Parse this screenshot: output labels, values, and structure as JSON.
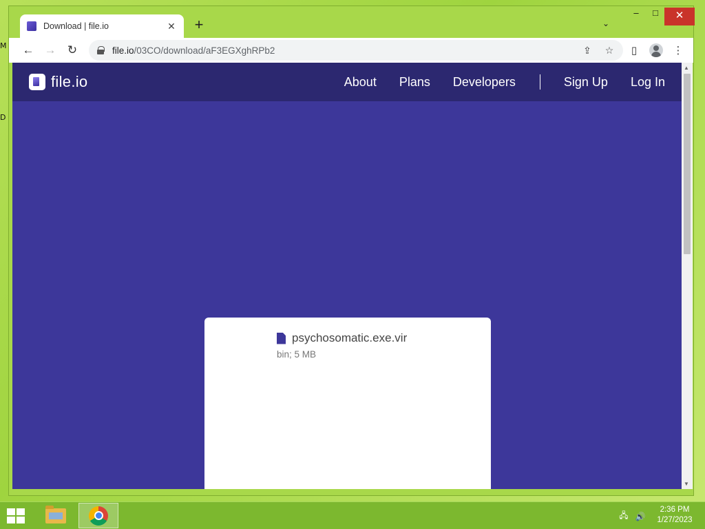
{
  "desktop": {
    "edge_labels": [
      "M",
      "D"
    ]
  },
  "browser": {
    "tab": {
      "title": "Download | file.io",
      "close": "✕"
    },
    "new_tab": "+",
    "tab_search": "⌄",
    "window_controls": {
      "minimize": "–",
      "maximize": "□",
      "close": "✕"
    },
    "nav": {
      "back": "←",
      "forward": "→",
      "reload": "↻"
    },
    "address": {
      "host": "file.io",
      "path": "/03CO/download/aF3EGXghRPb2"
    },
    "omnibox_icons": {
      "share": "⇪",
      "bookmark": "☆"
    },
    "toolbar_icons": {
      "side_panel": "▯",
      "menu": "⋮"
    }
  },
  "site": {
    "logo_text": "file.io",
    "nav": [
      "About",
      "Plans",
      "Developers",
      "Sign Up",
      "Log In"
    ],
    "file": {
      "name": "psychosomatic.exe.vir",
      "meta": "bin; 5 MB"
    }
  },
  "taskbar": {
    "clock_time": "2:36 PM",
    "clock_date": "1/27/2023",
    "tray": {
      "network": "🖧",
      "volume": "🔊"
    }
  },
  "colors": {
    "page_bg": "#3d379a",
    "header_bg": "#2c2870",
    "desktop_green": "#9fd43f",
    "close_red": "#c9342a"
  }
}
